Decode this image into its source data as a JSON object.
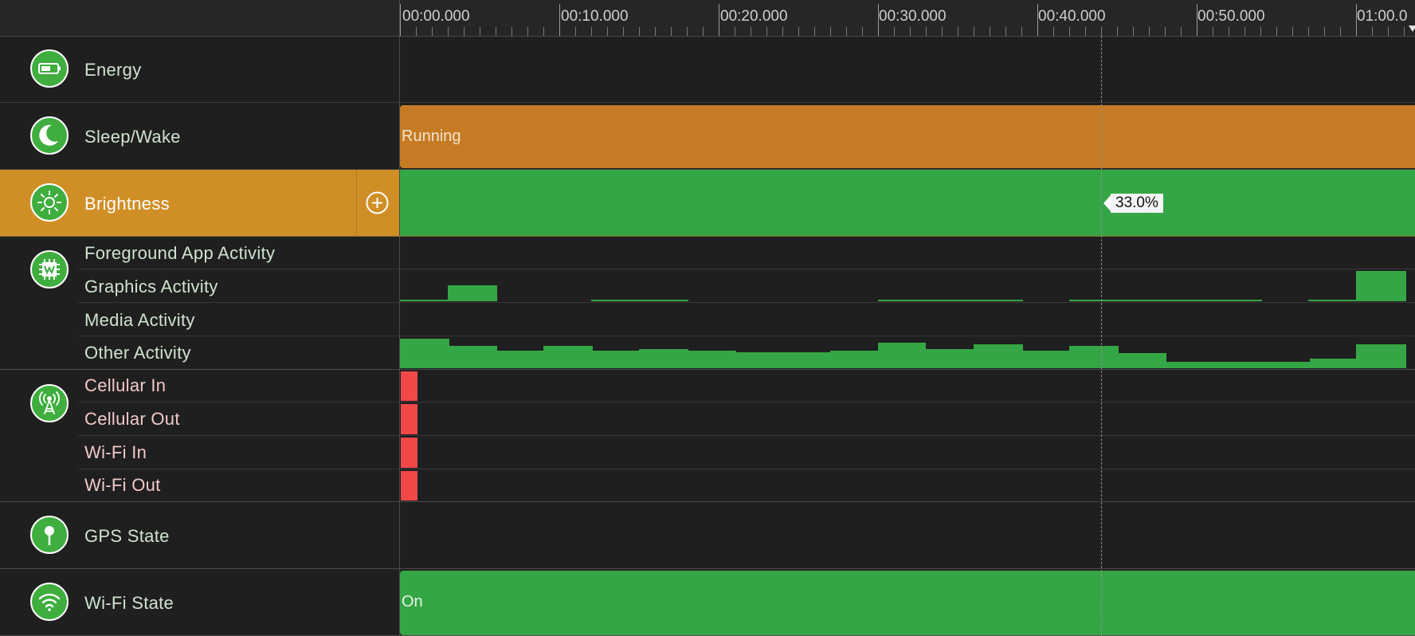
{
  "timeline": {
    "ticks": [
      "00:00.000",
      "00:10.000",
      "00:20.000",
      "00:30.000",
      "00:40.000",
      "00:50.000",
      "01:00.0"
    ],
    "cursor_value": "33.0%"
  },
  "tracks": {
    "energy": {
      "label": "Energy"
    },
    "sleep_wake": {
      "label": "Sleep/Wake",
      "state": "Running"
    },
    "brightness": {
      "label": "Brightness"
    },
    "activity": {
      "labels": [
        "Foreground App Activity",
        "Graphics Activity",
        "Media Activity",
        "Other Activity"
      ]
    },
    "network": {
      "labels": [
        "Cellular In",
        "Cellular Out",
        "Wi-Fi In",
        "Wi-Fi Out"
      ]
    },
    "gps": {
      "label": "GPS State"
    },
    "wifi_state": {
      "label": "Wi-Fi State",
      "state": "On"
    }
  },
  "colors": {
    "accent_orange": "#d08f26",
    "running_orange": "#c57b24",
    "green": "#35a645",
    "red": "#f24848",
    "icon_green": "#3fae3f"
  },
  "icons": {
    "energy": "battery-icon",
    "sleep_wake": "moon-icon",
    "brightness": "sun-icon",
    "activity": "chip-icon",
    "network": "cell-tower-icon",
    "gps": "pin-icon",
    "wifi_state": "wifi-icon",
    "add": "plus-circle-icon"
  }
}
